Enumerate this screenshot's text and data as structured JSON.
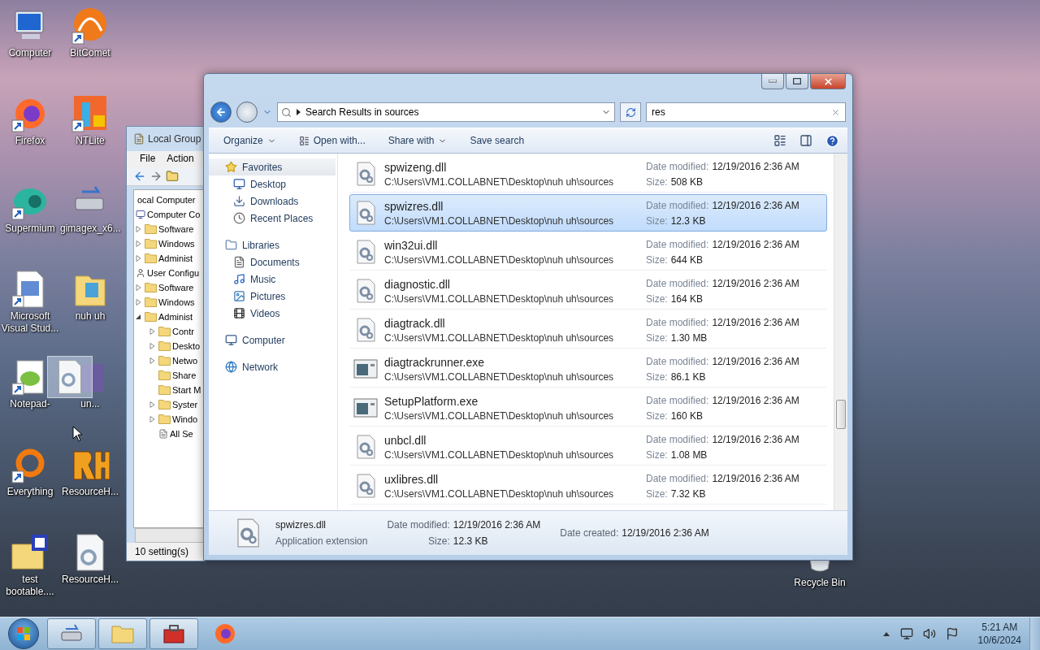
{
  "desktop_icons": [
    {
      "label": "Computer",
      "kind": "computer",
      "shortcut": false
    },
    {
      "label": "BitComet",
      "kind": "bitcomet",
      "shortcut": true
    },
    {
      "label": "Firefox",
      "kind": "firefox",
      "shortcut": true
    },
    {
      "label": "NTLite",
      "kind": "ntlite",
      "shortcut": true
    },
    {
      "label": "Supermium",
      "kind": "supermium",
      "shortcut": true
    },
    {
      "label": "gimagex_x6...",
      "kind": "drive",
      "shortcut": false
    },
    {
      "label": "Microsoft Visual Stud...",
      "kind": "document",
      "shortcut": true
    },
    {
      "label": "nuh uh",
      "kind": "folder",
      "shortcut": false
    },
    {
      "label": "Notepad-",
      "kind": "notepad",
      "shortcut": true
    },
    {
      "label": "un...",
      "kind": "tile",
      "shortcut": false
    },
    {
      "label": "Everything",
      "kind": "everything",
      "shortcut": true
    },
    {
      "label": "ResourceH...",
      "kind": "rh",
      "shortcut": false
    },
    {
      "label": "test bootable....",
      "kind": "wordfolder",
      "shortcut": false
    },
    {
      "label": "ResourceH...",
      "kind": "geardoc",
      "shortcut": false
    }
  ],
  "recycle_bin": {
    "label": "Recycle Bin"
  },
  "group_policy_window": {
    "title": "Local Group",
    "menu": [
      "File",
      "Action"
    ],
    "tree": [
      {
        "label": "ocal Computer",
        "children": [
          {
            "label": "Computer Co",
            "kind": "computer",
            "children": [
              {
                "label": "Software",
                "kind": "folder",
                "expanded": false
              },
              {
                "label": "Windows",
                "kind": "folder",
                "expanded": false
              },
              {
                "label": "Administ",
                "kind": "folder",
                "expanded": false
              }
            ]
          },
          {
            "label": "User Configu",
            "kind": "user",
            "children": [
              {
                "label": "Software",
                "kind": "folder",
                "expanded": false
              },
              {
                "label": "Windows",
                "kind": "folder",
                "expanded": false
              },
              {
                "label": "Administ",
                "kind": "folder",
                "expanded": true,
                "children": [
                  {
                    "label": "Contr",
                    "kind": "folder",
                    "expanded": false
                  },
                  {
                    "label": "Deskto",
                    "kind": "folder",
                    "expanded": false
                  },
                  {
                    "label": "Netwo",
                    "kind": "folder",
                    "expanded": false
                  },
                  {
                    "label": "Share",
                    "kind": "folder"
                  },
                  {
                    "label": "Start M",
                    "kind": "folder"
                  },
                  {
                    "label": "Syster",
                    "kind": "folder",
                    "expanded": false
                  },
                  {
                    "label": "Windo",
                    "kind": "folder",
                    "expanded": false
                  },
                  {
                    "label": "All Se",
                    "kind": "settings"
                  }
                ]
              }
            ]
          }
        ]
      }
    ],
    "status": "10 setting(s)"
  },
  "explorer": {
    "address": "Search Results in sources",
    "search": {
      "value": "res"
    },
    "commands": [
      {
        "label": "Organize",
        "dropdown": true,
        "icon": false
      },
      {
        "label": "Open with...",
        "dropdown": false,
        "icon": true
      },
      {
        "label": "Share with",
        "dropdown": true,
        "icon": false
      },
      {
        "label": "Save search",
        "dropdown": false,
        "icon": false
      }
    ],
    "nav_groups": [
      {
        "label": "Favorites",
        "kind": "star",
        "items": [
          {
            "label": "Desktop",
            "kind": "desktop"
          },
          {
            "label": "Downloads",
            "kind": "downloads"
          },
          {
            "label": "Recent Places",
            "kind": "recent"
          }
        ]
      },
      {
        "label": "Libraries",
        "kind": "libraries",
        "items": [
          {
            "label": "Documents",
            "kind": "documents"
          },
          {
            "label": "Music",
            "kind": "music"
          },
          {
            "label": "Pictures",
            "kind": "pictures"
          },
          {
            "label": "Videos",
            "kind": "videos"
          }
        ]
      },
      {
        "label": "Computer",
        "kind": "computer"
      },
      {
        "label": "Network",
        "kind": "network"
      }
    ],
    "files": [
      {
        "name": "spwizeng.dll",
        "kind": "dll",
        "selected": false,
        "path": "C:\\Users\\VM1.COLLABNET\\Desktop\\nuh uh\\sources",
        "date_label": "Date modified:",
        "date": "12/19/2016 2:36 AM",
        "size_label": "Size:",
        "size": "508 KB"
      },
      {
        "name": "spwizres.dll",
        "kind": "dll",
        "selected": true,
        "path": "C:\\Users\\VM1.COLLABNET\\Desktop\\nuh uh\\sources",
        "date_label": "Date modified:",
        "date": "12/19/2016 2:36 AM",
        "size_label": "Size:",
        "size": "12.3 KB"
      },
      {
        "name": "win32ui.dll",
        "kind": "dll",
        "selected": false,
        "path": "C:\\Users\\VM1.COLLABNET\\Desktop\\nuh uh\\sources",
        "date_label": "Date modified:",
        "date": "12/19/2016 2:36 AM",
        "size_label": "Size:",
        "size": "644 KB"
      },
      {
        "name": "diagnostic.dll",
        "kind": "dll",
        "selected": false,
        "path": "C:\\Users\\VM1.COLLABNET\\Desktop\\nuh uh\\sources",
        "date_label": "Date modified:",
        "date": "12/19/2016 2:36 AM",
        "size_label": "Size:",
        "size": "164 KB"
      },
      {
        "name": "diagtrack.dll",
        "kind": "dll",
        "selected": false,
        "path": "C:\\Users\\VM1.COLLABNET\\Desktop\\nuh uh\\sources",
        "date_label": "Date modified:",
        "date": "12/19/2016 2:36 AM",
        "size_label": "Size:",
        "size": "1.30 MB"
      },
      {
        "name": "diagtrackrunner.exe",
        "kind": "exe",
        "selected": false,
        "path": "C:\\Users\\VM1.COLLABNET\\Desktop\\nuh uh\\sources",
        "date_label": "Date modified:",
        "date": "12/19/2016 2:36 AM",
        "size_label": "Size:",
        "size": "86.1 KB"
      },
      {
        "name": "SetupPlatform.exe",
        "kind": "exe",
        "selected": false,
        "path": "C:\\Users\\VM1.COLLABNET\\Desktop\\nuh uh\\sources",
        "date_label": "Date modified:",
        "date": "12/19/2016 2:36 AM",
        "size_label": "Size:",
        "size": "160 KB"
      },
      {
        "name": "unbcl.dll",
        "kind": "dll",
        "selected": false,
        "path": "C:\\Users\\VM1.COLLABNET\\Desktop\\nuh uh\\sources",
        "date_label": "Date modified:",
        "date": "12/19/2016 2:36 AM",
        "size_label": "Size:",
        "size": "1.08 MB"
      },
      {
        "name": "uxlibres.dll",
        "kind": "dll",
        "selected": false,
        "path": "C:\\Users\\VM1.COLLABNET\\Desktop\\nuh uh\\sources",
        "date_label": "Date modified:",
        "date": "12/19/2016 2:36 AM",
        "size_label": "Size:",
        "size": "7.32 KB"
      }
    ],
    "details": {
      "name": "spwizres.dll",
      "type": "Application extension",
      "fields": [
        {
          "label": "Date modified:",
          "value": "12/19/2016 2:36 AM"
        },
        {
          "label": "Size:",
          "value": "12.3 KB"
        },
        {
          "label": "Date created:",
          "value": "12/19/2016 2:36 AM"
        }
      ]
    }
  },
  "taskbar": {
    "items": [
      {
        "kind": "drive",
        "open": true
      },
      {
        "kind": "folder",
        "open": true
      },
      {
        "kind": "toolbox",
        "open": true
      },
      {
        "kind": "firefox",
        "open": false
      }
    ],
    "clock": {
      "time": "5:21 AM",
      "date": "10/6/2024"
    }
  }
}
